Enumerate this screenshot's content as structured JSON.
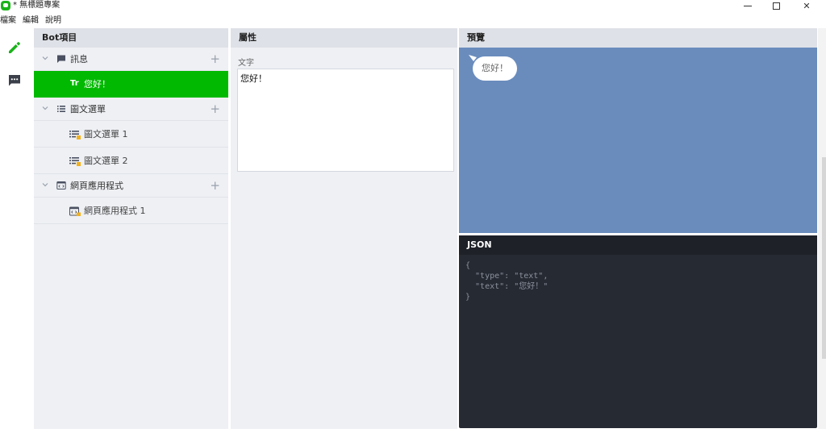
{
  "window": {
    "title": "* 無標題專案",
    "min_icon": "minimize-icon",
    "max_icon": "maximize-icon",
    "close_glyph": "✕"
  },
  "menu": [
    "檔案",
    "編輯",
    "說明"
  ],
  "rail": {
    "items": [
      {
        "name": "pencil-icon",
        "color": "#19b319"
      },
      {
        "name": "chat-icon",
        "color": "#3a3f4a"
      }
    ]
  },
  "bot_panel": {
    "header": "Bot項目",
    "groups": [
      {
        "label": "訊息",
        "icon": "message-icon",
        "add": "+",
        "children": [
          {
            "label": "您好！",
            "icon": "text-icon",
            "glyph": "Tr",
            "selected": true
          }
        ]
      },
      {
        "label": "圖文選單",
        "icon": "list-icon",
        "add": "+",
        "children": [
          {
            "label": "圖文選單 1",
            "icon": "rich-menu-icon"
          },
          {
            "label": "圖文選單 2",
            "icon": "rich-menu-icon"
          }
        ]
      },
      {
        "label": "網頁應用程式",
        "icon": "webapp-icon",
        "add": "+",
        "children": [
          {
            "label": "網頁應用程式 1",
            "icon": "webapp-item-icon"
          }
        ]
      }
    ]
  },
  "props_panel": {
    "header": "屬性",
    "field_label": "文字",
    "field_value": "您好！"
  },
  "preview_panel": {
    "header": "預覽",
    "bubble_text": "您好！",
    "bg_color": "#6a8cbd"
  },
  "json_panel": {
    "header": "JSON",
    "lines": [
      "{",
      "  \"type\": \"text\",",
      "  \"text\": \"您好！\"",
      "}"
    ]
  },
  "colors": {
    "accent": "#00b900",
    "panel_bg": "#eef0f4",
    "json_bg": "#262a33"
  }
}
